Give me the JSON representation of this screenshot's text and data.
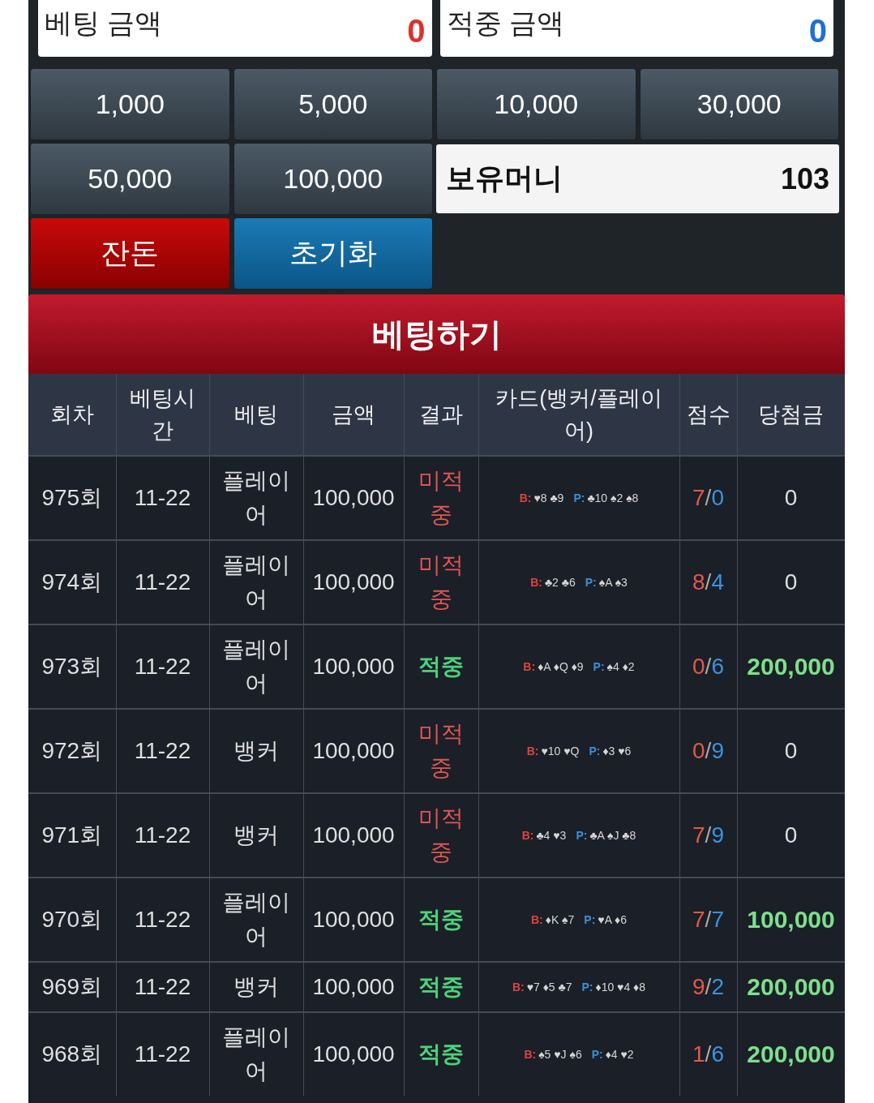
{
  "bet_amount": {
    "label": "베팅 금액",
    "value": "0"
  },
  "win_amount": {
    "label": "적중 금액",
    "value": "0"
  },
  "chips": [
    "1,000",
    "5,000",
    "10,000",
    "30,000",
    "50,000",
    "100,000"
  ],
  "balance": {
    "label": "보유머니",
    "value": "103"
  },
  "actions": [
    {
      "label": "잔돈",
      "kind": "change"
    },
    {
      "label": "초기화",
      "kind": "reset"
    }
  ],
  "submit": "베팅하기",
  "table": {
    "columns": [
      "회차",
      "베팅시간",
      "베팅",
      "금액",
      "결과",
      "카드(뱅커/플레이어)",
      "점수",
      "당첨금"
    ],
    "rows": [
      {
        "round": "975회",
        "time": "11-22",
        "bet": "플레이어",
        "amount": "100,000",
        "result": "미적중",
        "kind": "lose",
        "cards": {
          "b_label": "B:",
          "banker": "♥8 ♣9",
          "p_label": "P:",
          "player": "♣10 ♠2 ♠8"
        },
        "score": {
          "banker": "7",
          "sep": "/",
          "player": "0"
        },
        "prize": "0"
      },
      {
        "round": "974회",
        "time": "11-22",
        "bet": "플레이어",
        "amount": "100,000",
        "result": "미적중",
        "kind": "lose",
        "cards": {
          "b_label": "B:",
          "banker": "♣2 ♣6",
          "p_label": "P:",
          "player": "♠A ♠3"
        },
        "score": {
          "banker": "8",
          "sep": "/",
          "player": "4"
        },
        "prize": "0"
      },
      {
        "round": "973회",
        "time": "11-22",
        "bet": "플레이어",
        "amount": "100,000",
        "result": "적중",
        "kind": "win",
        "cards": {
          "b_label": "B:",
          "banker": "♦A ♦Q ♦9",
          "p_label": "P:",
          "player": "♠4 ♦2"
        },
        "score": {
          "banker": "0",
          "sep": "/",
          "player": "6"
        },
        "prize": "200,000"
      },
      {
        "round": "972회",
        "time": "11-22",
        "bet": "뱅커",
        "amount": "100,000",
        "result": "미적중",
        "kind": "lose",
        "cards": {
          "b_label": "B:",
          "banker": "♥10 ♥Q",
          "p_label": "P:",
          "player": "♦3 ♥6"
        },
        "score": {
          "banker": "0",
          "sep": "/",
          "player": "9"
        },
        "prize": "0"
      },
      {
        "round": "971회",
        "time": "11-22",
        "bet": "뱅커",
        "amount": "100,000",
        "result": "미적중",
        "kind": "lose",
        "cards": {
          "b_label": "B:",
          "banker": "♣4 ♥3",
          "p_label": "P:",
          "player": "♣A ♠J ♣8"
        },
        "score": {
          "banker": "7",
          "sep": "/",
          "player": "9"
        },
        "prize": "0"
      },
      {
        "round": "970회",
        "time": "11-22",
        "bet": "플레이어",
        "amount": "100,000",
        "result": "적중",
        "kind": "win",
        "cards": {
          "b_label": "B:",
          "banker": "♦K ♠7",
          "p_label": "P:",
          "player": "♥A ♦6"
        },
        "score": {
          "banker": "7",
          "sep": "/",
          "player": "7"
        },
        "prize": "100,000"
      },
      {
        "round": "969회",
        "time": "11-22",
        "bet": "뱅커",
        "amount": "100,000",
        "result": "적중",
        "kind": "win",
        "cards": {
          "b_label": "B:",
          "banker": "♥7 ♦5 ♣7",
          "p_label": "P:",
          "player": "♦10 ♥4 ♦8"
        },
        "score": {
          "banker": "9",
          "sep": "/",
          "player": "2"
        },
        "prize": "200,000"
      },
      {
        "round": "968회",
        "time": "11-22",
        "bet": "플레이어",
        "amount": "100,000",
        "result": "적중",
        "kind": "win",
        "cards": {
          "b_label": "B:",
          "banker": "♠5 ♥J ♠6",
          "p_label": "P:",
          "player": "♦4 ♥2"
        },
        "score": {
          "banker": "1",
          "sep": "/",
          "player": "6"
        },
        "prize": "200,000"
      }
    ]
  }
}
